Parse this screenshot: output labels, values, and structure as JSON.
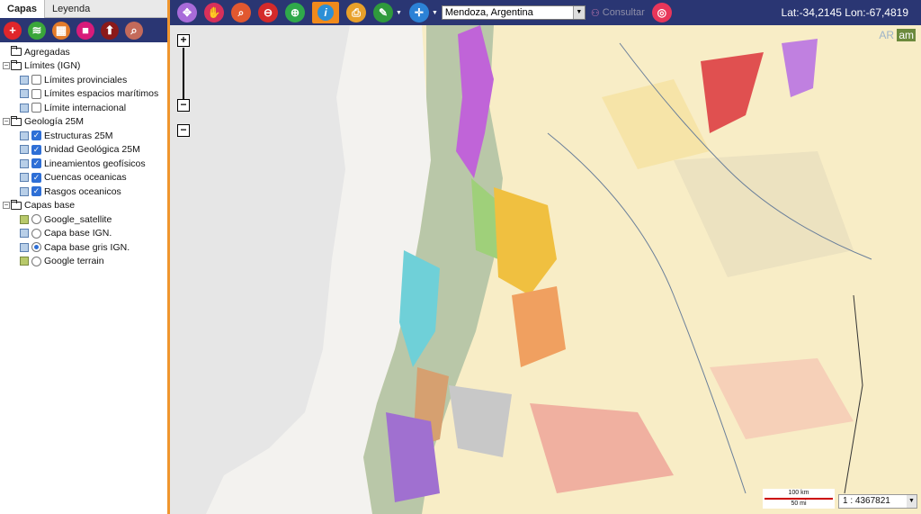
{
  "sidebar": {
    "tabs": [
      {
        "label": "Capas"
      },
      {
        "label": "Leyenda"
      }
    ],
    "tree": {
      "agregadas": "Agregadas",
      "limites": {
        "label": "Límites (IGN)",
        "items": [
          {
            "label": "Límites provinciales",
            "checked": false
          },
          {
            "label": "Límites espacios marítimos",
            "checked": false
          },
          {
            "label": "Límite internacional",
            "checked": false
          }
        ]
      },
      "geologia": {
        "label": "Geología 25M",
        "items": [
          {
            "label": "Estructuras 25M",
            "checked": true
          },
          {
            "label": "Unidad Geológica 25M",
            "checked": true
          },
          {
            "label": "Lineamientos geofísicos",
            "checked": true
          },
          {
            "label": "Cuencas oceanicas",
            "checked": true
          },
          {
            "label": "Rasgos oceanicos",
            "checked": true
          }
        ]
      },
      "base": {
        "label": "Capas base",
        "items": [
          {
            "label": "Google_satellite",
            "selected": false
          },
          {
            "label": "Capa base IGN.",
            "selected": false
          },
          {
            "label": "Capa base gris IGN.",
            "selected": true
          },
          {
            "label": "Google terrain",
            "selected": false
          }
        ]
      }
    }
  },
  "topbar": {
    "search_value": "Mendoza, Argentina",
    "consultar": "Consultar",
    "coords": "Lat:-34,2145 Lon:-67,4819"
  },
  "map": {
    "scale_km": "100 km",
    "scale_mi": "50 mi",
    "scale_ratio": "1 : 4367821",
    "watermark_a": "AR",
    "watermark_b": "am"
  },
  "colors": {
    "accent": "#f08a1c",
    "navy": "#2a3673",
    "check": "#2e6fd6"
  }
}
